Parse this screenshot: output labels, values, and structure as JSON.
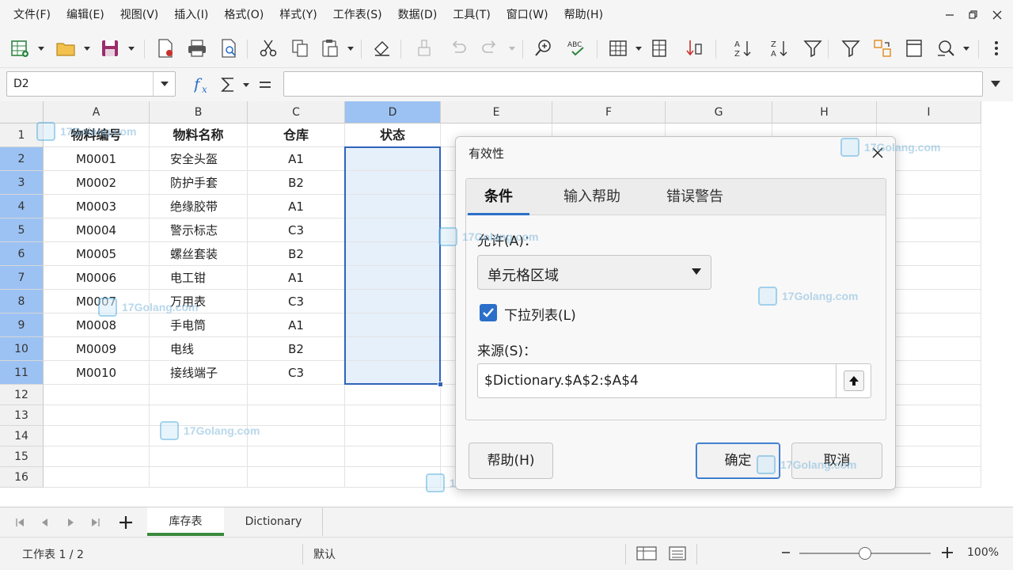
{
  "menu": [
    "文件(F)",
    "编辑(E)",
    "视图(V)",
    "插入(I)",
    "格式(O)",
    "样式(Y)",
    "工作表(S)",
    "数据(D)",
    "工具(T)",
    "窗口(W)",
    "帮助(H)"
  ],
  "toolbar": {
    "spellcheck_label": "ABC"
  },
  "formula_bar": {
    "name_box": "D2",
    "formula": ""
  },
  "columns": [
    "A",
    "B",
    "C",
    "D",
    "E",
    "F",
    "G",
    "H",
    "I"
  ],
  "rows": [
    "1",
    "2",
    "3",
    "4",
    "5",
    "6",
    "7",
    "8",
    "9",
    "10",
    "11",
    "12",
    "13",
    "14",
    "15",
    "16"
  ],
  "table": {
    "headers": [
      "物料编号",
      "物料名称",
      "仓库",
      "状态"
    ],
    "data": [
      [
        "M0001",
        "安全头盔",
        "A1"
      ],
      [
        "M0002",
        "防护手套",
        "B2"
      ],
      [
        "M0003",
        "绝缘胶带",
        "A1"
      ],
      [
        "M0004",
        "警示标志",
        "C3"
      ],
      [
        "M0005",
        "螺丝套装",
        "B2"
      ],
      [
        "M0006",
        "电工钳",
        "A1"
      ],
      [
        "M0007",
        "万用表",
        "C3"
      ],
      [
        "M0008",
        "手电筒",
        "A1"
      ],
      [
        "M0009",
        "电线",
        "B2"
      ],
      [
        "M0010",
        "接线端子",
        "C3"
      ]
    ]
  },
  "sheet_tabs": [
    "库存表",
    "Dictionary"
  ],
  "status": {
    "sheet_info": "工作表 1 / 2",
    "style": "默认",
    "zoom": "100%",
    "zoom_level": 0.5
  },
  "dialog": {
    "title": "有效性",
    "tabs": [
      "条件",
      "输入帮助",
      "错误警告"
    ],
    "allow_label": "允许(A)：",
    "allow_value": "单元格区域",
    "dropdown_label": "下拉列表(L)",
    "dropdown_checked": true,
    "source_label": "来源(S)：",
    "source_value": "$Dictionary.$A$2:$A$4",
    "help_button": "帮助(H)",
    "ok_button": "确定",
    "cancel_button": "取消"
  },
  "watermark": "17Golang.com",
  "colors": {
    "selection": "#2f63b8",
    "selected_header": "#9cc2f3",
    "active_tab_underline": "#3b8a3e"
  }
}
